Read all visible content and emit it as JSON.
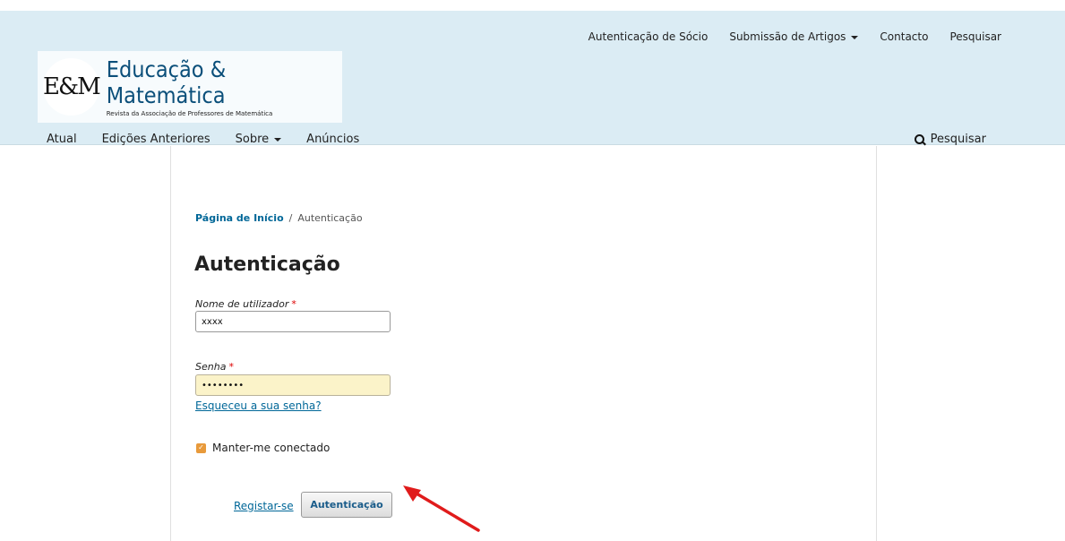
{
  "user_nav": {
    "member_login": "Autenticação de Sócio",
    "submission": "Submissão de Artigos",
    "contact": "Contacto",
    "search": "Pesquisar"
  },
  "logo": {
    "mark": "E&M",
    "title": "Educação & Matemática",
    "subtitle": "Revista da Associação de Professores de Matemática"
  },
  "primary_nav": {
    "items": [
      "Atual",
      "Edições Anteriores",
      "Sobre",
      "Anúncios"
    ],
    "search_label": "Pesquisar"
  },
  "breadcrumb": {
    "home": "Página de Início",
    "separator": "/",
    "current": "Autenticação"
  },
  "login": {
    "title": "Autenticação",
    "username_label": "Nome de utilizador",
    "username_value": "xxxx",
    "password_label": "Senha",
    "password_value": "••••••••",
    "required_marker": "*",
    "forgot_link": "Esqueceu a sua senha?",
    "remember_label": "Manter-me conectado",
    "register_link": "Registar-se",
    "submit_label": "Autenticação"
  },
  "colors": {
    "header_bg": "#dbecf4",
    "link": "#006798",
    "arrow": "#e01b1b"
  }
}
